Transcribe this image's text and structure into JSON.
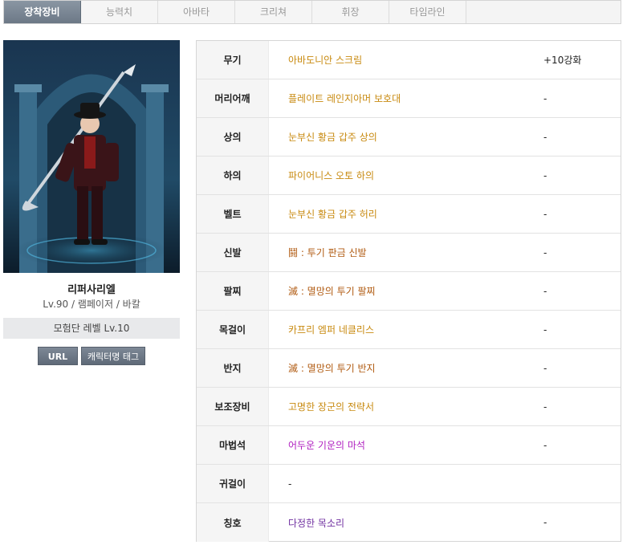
{
  "tabs": [
    {
      "label": "장착장비",
      "active": true
    },
    {
      "label": "능력치",
      "active": false
    },
    {
      "label": "아바타",
      "active": false
    },
    {
      "label": "크리쳐",
      "active": false
    },
    {
      "label": "휘장",
      "active": false
    },
    {
      "label": "타임라인",
      "active": false
    }
  ],
  "character": {
    "name": "리퍼사리엘",
    "info": "Lv.90 / 램페이저 / 바칼",
    "adventure_level": "모험단 레벨 Lv.10",
    "url_button": "URL",
    "tag_button": "캐릭터명 태그"
  },
  "colors": {
    "rarity_unique": "#c88a10",
    "rarity_epic": "#b05a10",
    "rarity_rare": "#b020c0",
    "rarity_title": "#7030a0"
  },
  "equipment": [
    {
      "slot": "무기",
      "item": "아바도니안 스크림",
      "color": "#c88a10",
      "extra": "+10강화"
    },
    {
      "slot": "머리어깨",
      "item": "플레이트 레인지아머 보호대",
      "color": "#c88a10",
      "extra": "-"
    },
    {
      "slot": "상의",
      "item": "눈부신 황금 갑주 상의",
      "color": "#c88a10",
      "extra": "-"
    },
    {
      "slot": "하의",
      "item": "파이어니스 오토 하의",
      "color": "#c88a10",
      "extra": "-"
    },
    {
      "slot": "벨트",
      "item": "눈부신 황금 갑주 허리",
      "color": "#c88a10",
      "extra": "-"
    },
    {
      "slot": "신발",
      "item": "鬪 : 투기 판금 신발",
      "color": "#b05a10",
      "extra": "-"
    },
    {
      "slot": "팔찌",
      "item": "滅 : 멸망의 투기 팔찌",
      "color": "#b05a10",
      "extra": "-"
    },
    {
      "slot": "목걸이",
      "item": "카프리 엠퍼 네클리스",
      "color": "#c88a10",
      "extra": "-"
    },
    {
      "slot": "반지",
      "item": "滅 : 멸망의 투기 반지",
      "color": "#b05a10",
      "extra": "-"
    },
    {
      "slot": "보조장비",
      "item": "고명한 장군의 전략서",
      "color": "#c88a10",
      "extra": "-"
    },
    {
      "slot": "마법석",
      "item": "어두운 기운의 마석",
      "color": "#b020c0",
      "extra": "-"
    },
    {
      "slot": "귀걸이",
      "item": "-",
      "color": "#222222",
      "extra": ""
    },
    {
      "slot": "칭호",
      "item": "다정한 목소리",
      "color": "#7030a0",
      "extra": "-"
    }
  ]
}
